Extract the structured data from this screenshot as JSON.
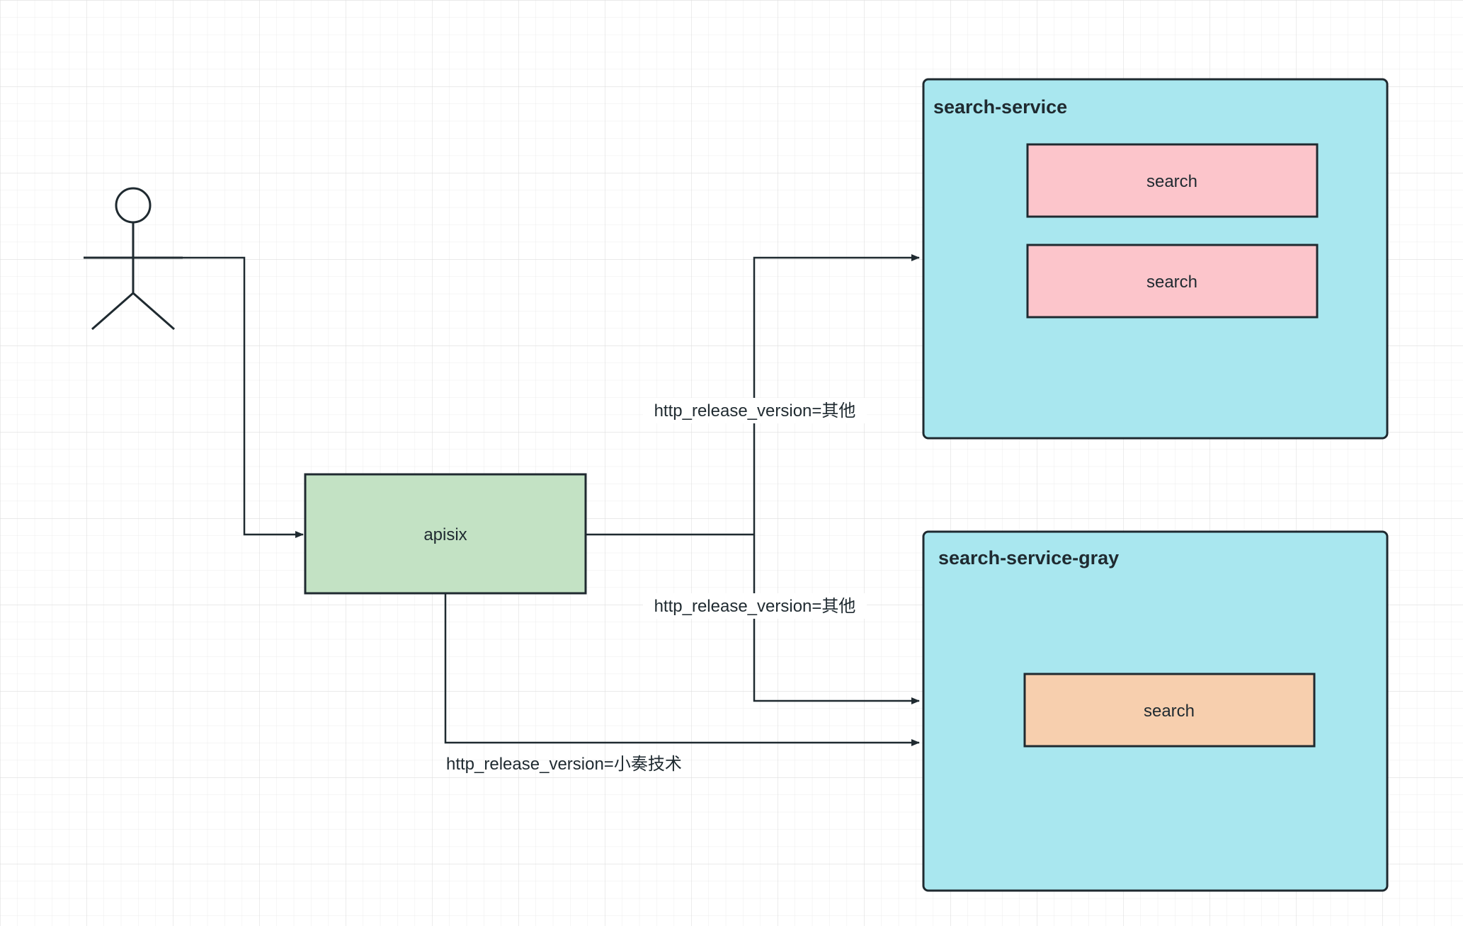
{
  "nodes": {
    "apisix": {
      "label": "apisix",
      "fill": "#c3e2c4"
    },
    "search_service": {
      "title": "search-service",
      "fill": "#a9e7ef",
      "instances": [
        {
          "label": "search",
          "fill": "#fcc5cb"
        },
        {
          "label": "search",
          "fill": "#fcc5cb"
        }
      ]
    },
    "search_service_gray": {
      "title": "search-service-gray",
      "fill": "#a9e7ef",
      "instances": [
        {
          "label": "search",
          "fill": "#f7cfae"
        }
      ]
    }
  },
  "edges": {
    "to_search_service": {
      "label": "http_release_version=其他"
    },
    "to_gray_branch": {
      "label": "http_release_version=其他"
    },
    "to_gray_bottom": {
      "label": "http_release_version=小奏技术"
    }
  },
  "colors": {
    "stroke": "#1f2a30",
    "grid": "#e6e6e6"
  }
}
